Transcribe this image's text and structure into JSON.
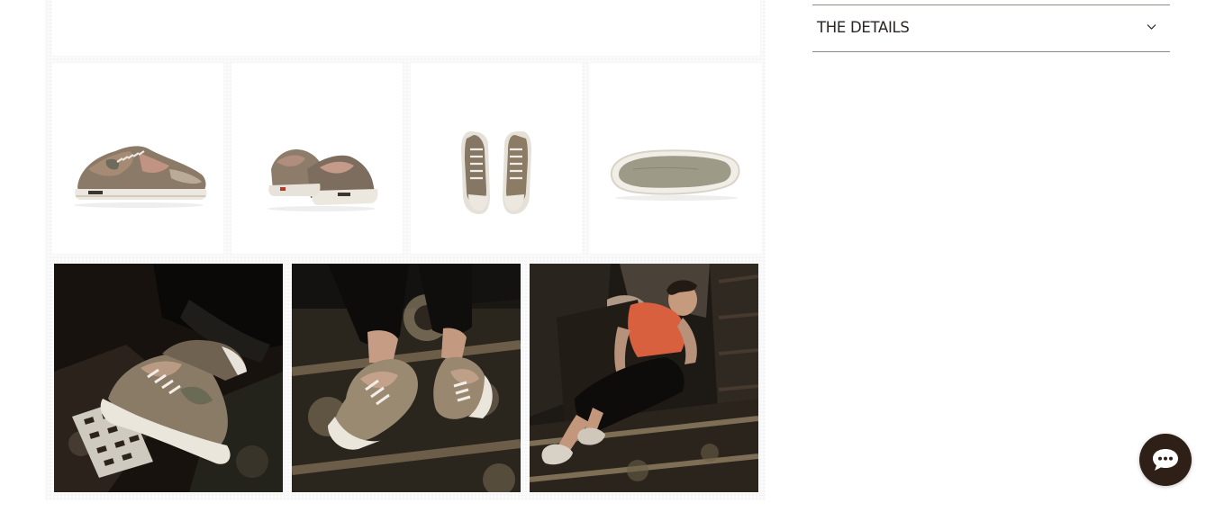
{
  "accordion": {
    "title": "THE DETAILS",
    "toggle_icon": "chevron-down-icon",
    "expanded": false
  },
  "gallery": {
    "thumbnails": [
      {
        "view": "side-view"
      },
      {
        "view": "back-view"
      },
      {
        "view": "top-view"
      },
      {
        "view": "sole-view"
      }
    ],
    "lifestyle_photos": [
      {
        "scene": "shoes-on-tiles"
      },
      {
        "scene": "shoes-on-rug"
      },
      {
        "scene": "woman-seated-on-rug"
      }
    ]
  },
  "chat": {
    "icon": "chat-bubble-icon",
    "bubble_color": "#2e1f17"
  },
  "colors": {
    "divider": "#8d8a86",
    "text": "#2b2623",
    "accent_shirt": "#d9603e"
  }
}
